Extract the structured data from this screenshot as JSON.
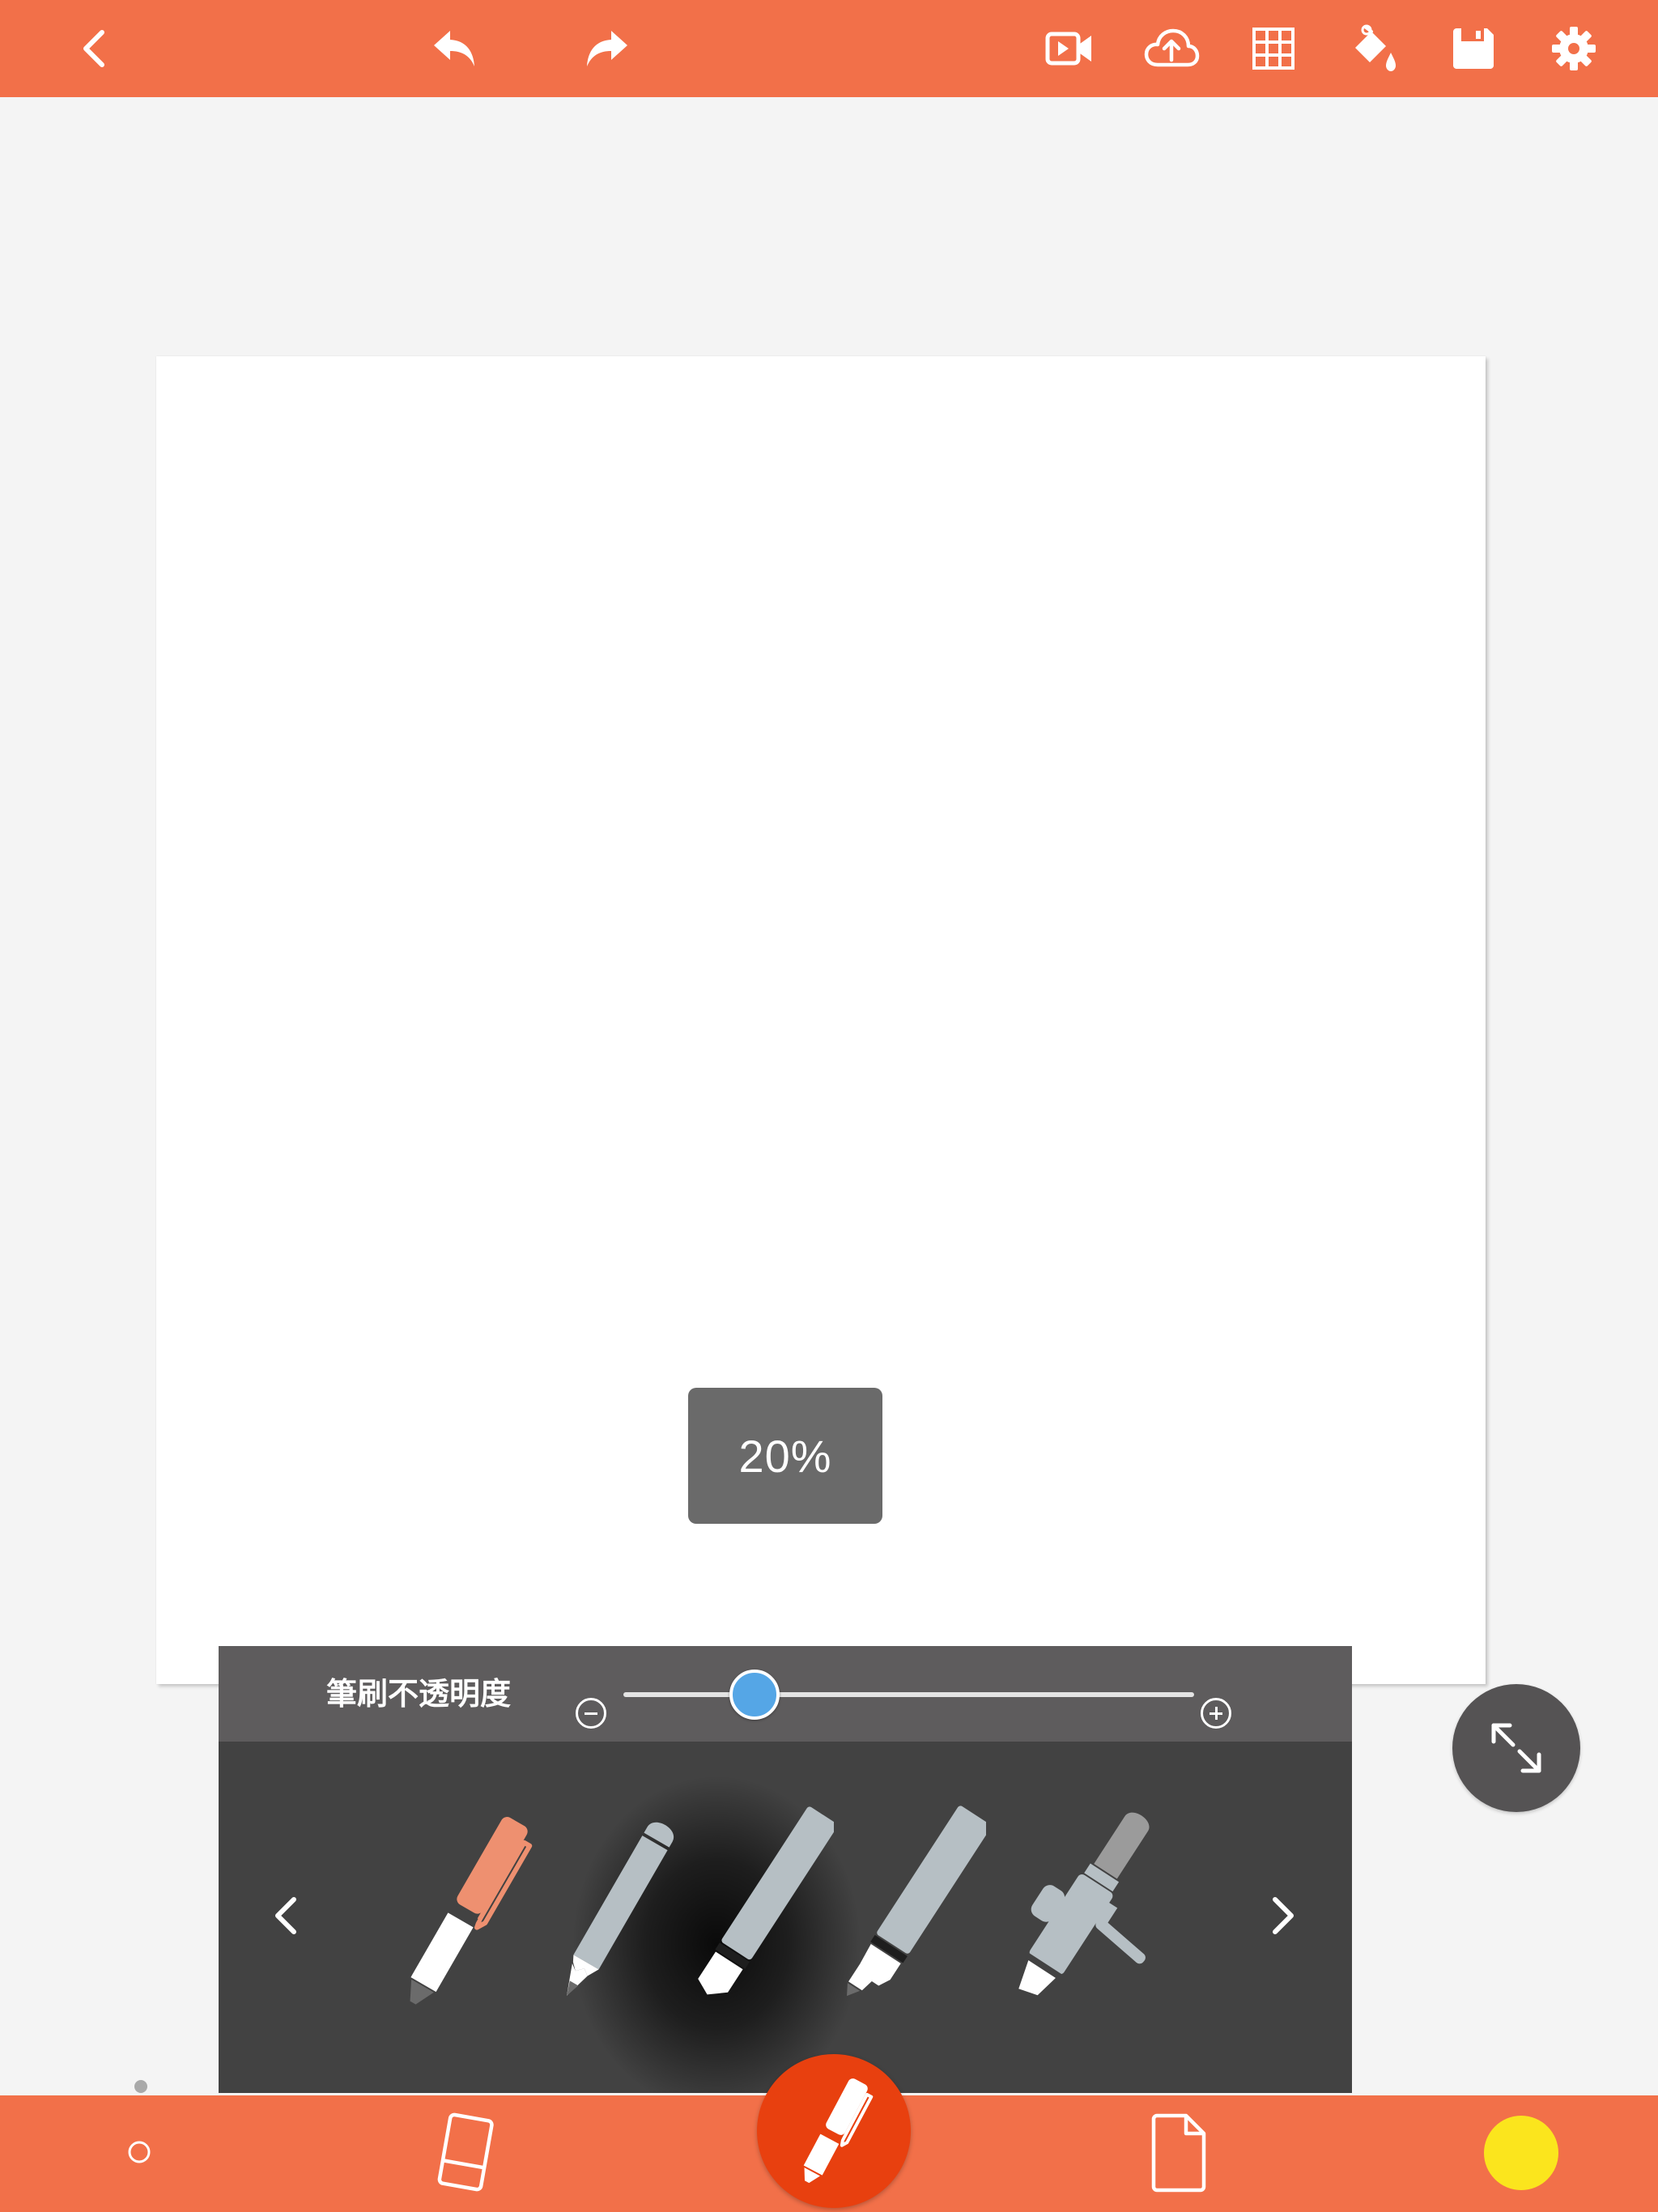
{
  "top_toolbar": {
    "buttons": [
      {
        "name": "back",
        "icon": "chevron-left-icon"
      },
      {
        "name": "undo",
        "icon": "undo-icon"
      },
      {
        "name": "redo",
        "icon": "redo-icon"
      },
      {
        "name": "video",
        "icon": "video-record-icon"
      },
      {
        "name": "upload",
        "icon": "cloud-upload-icon"
      },
      {
        "name": "grid",
        "icon": "grid-icon"
      },
      {
        "name": "fill",
        "icon": "paint-bucket-icon"
      },
      {
        "name": "save",
        "icon": "floppy-disk-icon"
      },
      {
        "name": "settings",
        "icon": "gear-icon"
      }
    ]
  },
  "opacity_toast": {
    "value": "20%"
  },
  "brush_panel": {
    "opacity_label": "筆刷不透明度",
    "opacity_fraction": 0.23,
    "decrease_icon": "minus-circle-icon",
    "increase_icon": "plus-circle-icon",
    "tools": [
      {
        "name": "pen",
        "icon": "pen-icon",
        "selected": true
      },
      {
        "name": "pencil",
        "icon": "pencil-icon",
        "selected": false
      },
      {
        "name": "marker",
        "icon": "marker-icon",
        "selected": false
      },
      {
        "name": "highlighter",
        "icon": "highlighter-icon",
        "selected": false
      },
      {
        "name": "airbrush",
        "icon": "airbrush-icon",
        "selected": false
      }
    ],
    "prev_icon": "chevron-left-icon",
    "next_icon": "chevron-right-icon"
  },
  "fullscreen_button": {
    "icon": "expand-arrows-icon"
  },
  "bottom_toolbar": {
    "brush_size_icon": "brush-size-dot-icon",
    "eraser_icon": "eraser-icon",
    "active_tool_icon": "pen-icon",
    "layers_icon": "page-icon",
    "current_color": "#fbe51d"
  },
  "colors": {
    "toolbar": "#f27049",
    "active_fab": "#e8400f",
    "panel_dark": "#424242",
    "panel_header": "#5e5c5d",
    "slider_thumb": "#55a6e6",
    "selected_tool": "#ee9070",
    "inactive_tool": "#b6bfc4"
  }
}
